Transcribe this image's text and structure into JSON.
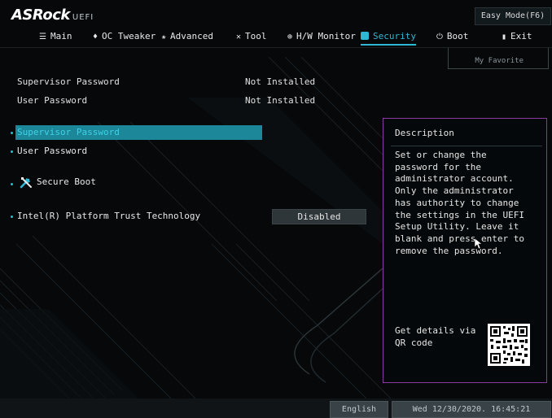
{
  "brand": {
    "name": "ASRock",
    "suffix": "UEFI"
  },
  "header": {
    "easy_mode": "Easy Mode(F6)"
  },
  "tabs": [
    {
      "label": "Main",
      "icon": "list-icon",
      "glyph": "☰"
    },
    {
      "label": "OC Tweaker",
      "icon": "flame-icon",
      "glyph": "♦"
    },
    {
      "label": "Advanced",
      "icon": "star-icon",
      "glyph": "✬"
    },
    {
      "label": "Tool",
      "icon": "tools-icon",
      "glyph": "✕"
    },
    {
      "label": "H/W Monitor",
      "icon": "monitor-icon",
      "glyph": "⊕"
    },
    {
      "label": "Security",
      "icon": "shield-icon",
      "glyph": "■"
    },
    {
      "label": "Boot",
      "icon": "power-icon",
      "glyph": "⏻"
    },
    {
      "label": "Exit",
      "icon": "exit-icon",
      "glyph": "▮"
    }
  ],
  "active_tab": "Security",
  "my_favorite": "My Favorite",
  "status": [
    {
      "label": "Supervisor Password",
      "value": "Not Installed"
    },
    {
      "label": "User Password",
      "value": "Not Installed"
    }
  ],
  "menu": {
    "supervisor_password": "Supervisor Password",
    "user_password": "User Password",
    "secure_boot": "Secure Boot",
    "ptt_label": "Intel(R) Platform Trust Technology",
    "ptt_value": "Disabled"
  },
  "description": {
    "title": "Description",
    "text": "Set or change the password for the administrator account. Only the administrator has authority to change the settings in the UEFI Setup Utility. Leave it blank and press enter to remove the password.",
    "qr_text": "Get details via QR code"
  },
  "footer": {
    "language": "English",
    "datetime": "Wed 12/30/2020. 16:45:21"
  },
  "colors": {
    "accent": "#2fb8d3",
    "selection": "#1c8798",
    "panel_border": "#8a3a9e",
    "background": "#06080a"
  }
}
